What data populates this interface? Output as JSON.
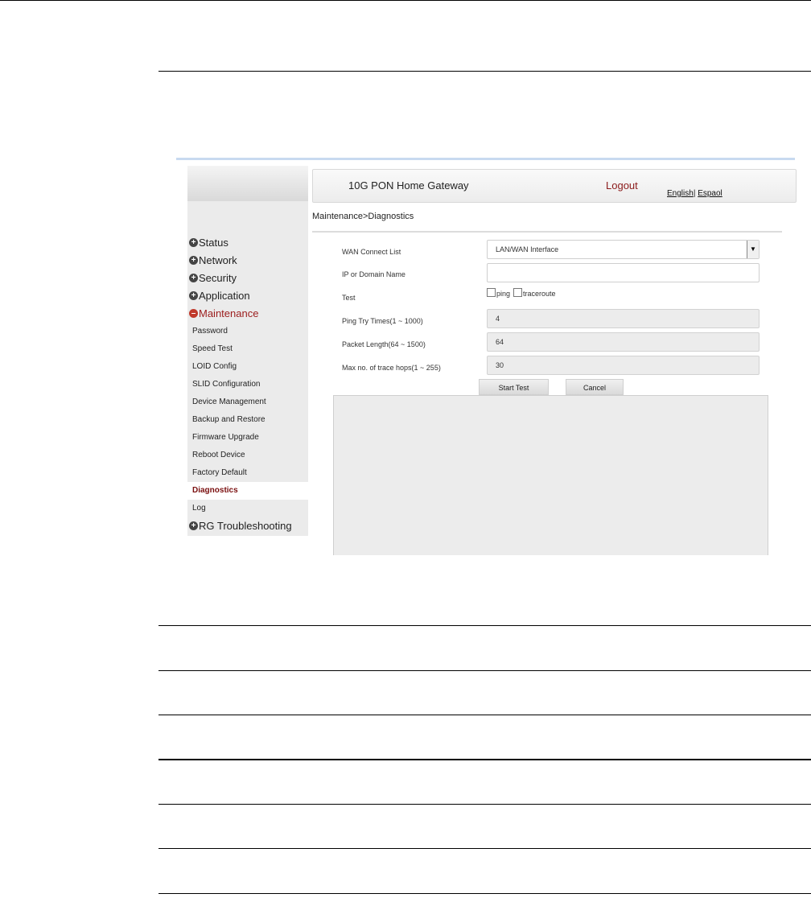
{
  "header": {
    "title": "10G PON Home Gateway",
    "logout": "Logout",
    "lang_english": "English",
    "lang_sep": "|",
    "lang_espanol": "Espaol"
  },
  "sidebar": {
    "menu": [
      {
        "label": "Status",
        "icon": "plus-circle-icon"
      },
      {
        "label": "Network",
        "icon": "plus-circle-icon"
      },
      {
        "label": "Security",
        "icon": "plus-circle-icon"
      },
      {
        "label": "Application",
        "icon": "plus-circle-icon"
      },
      {
        "label": "Maintenance",
        "icon": "minus-circle-icon"
      }
    ],
    "sub": [
      "Password",
      "Speed Test",
      "LOID Config",
      "SLID Configuration",
      "Device Management",
      "Backup and Restore",
      "Firmware Upgrade",
      "Reboot Device",
      "Factory Default",
      "Diagnostics",
      "Log"
    ],
    "last": {
      "label": "RG Troubleshooting",
      "icon": "plus-circle-icon"
    },
    "active": "Diagnostics"
  },
  "breadcrumb": "Maintenance>Diagnostics",
  "form": {
    "wan_label": "WAN Connect List",
    "wan_value": "LAN/WAN Interface",
    "ip_label": "IP or Domain Name",
    "ip_value": "",
    "test_label": "Test",
    "test_ping": "ping",
    "test_traceroute": "traceroute",
    "ping_label": "Ping Try Times(1 ~ 1000)",
    "ping_value": "4",
    "packet_label": "Packet Length(64 ~ 1500)",
    "packet_value": "64",
    "hops_label": "Max no. of trace hops(1 ~ 255)",
    "hops_value": "30"
  },
  "buttons": {
    "start": "Start Test",
    "cancel": "Cancel"
  }
}
